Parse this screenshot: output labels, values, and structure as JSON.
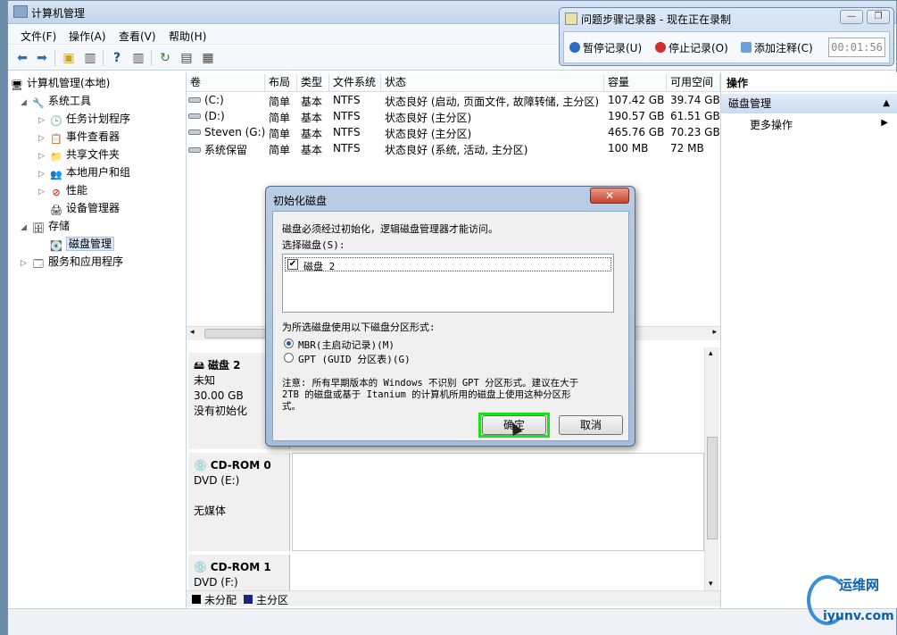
{
  "window": {
    "title": "计算机管理"
  },
  "menu": [
    "文件(F)",
    "操作(A)",
    "查看(V)",
    "帮助(H)"
  ],
  "toolbar": {
    "icons": [
      "back-arrow-icon",
      "forward-arrow-icon",
      "up-folder-icon",
      "show-hide-tree-icon",
      "help-icon",
      "show-hide-action-pane-icon",
      "refresh-icon",
      "properties-icon",
      "export-list-icon"
    ]
  },
  "tree": {
    "root": "计算机管理(本地)",
    "system_tools": "系统工具",
    "task_scheduler": "任务计划程序",
    "event_viewer": "事件查看器",
    "shared_folders": "共享文件夹",
    "local_users": "本地用户和组",
    "performance": "性能",
    "device_manager": "设备管理器",
    "storage": "存储",
    "disk_management": "磁盘管理",
    "services_apps": "服务和应用程序"
  },
  "volumes": {
    "headers": [
      "卷",
      "布局",
      "类型",
      "文件系统",
      "状态",
      "容量",
      "可用空间"
    ],
    "rows": [
      [
        "(C:)",
        "简单",
        "基本",
        "NTFS",
        "状态良好 (启动, 页面文件, 故障转储, 主分区)",
        "107.42 GB",
        "39.74 GB"
      ],
      [
        "(D:)",
        "简单",
        "基本",
        "NTFS",
        "状态良好 (主分区)",
        "190.57 GB",
        "61.51 GB"
      ],
      [
        "Steven (G:)",
        "简单",
        "基本",
        "NTFS",
        "状态良好 (主分区)",
        "465.76 GB",
        "70.23 GB"
      ],
      [
        "系统保留",
        "简单",
        "基本",
        "NTFS",
        "状态良好 (系统, 活动, 主分区)",
        "100 MB",
        "72 MB"
      ]
    ]
  },
  "disks": [
    {
      "name": "磁盘 2",
      "type": "未知",
      "size": "30.00 GB",
      "status": "没有初始化"
    },
    {
      "name": "CD-ROM 0",
      "type": "DVD (E:)",
      "size": "",
      "status": "无媒体"
    },
    {
      "name": "CD-ROM 1",
      "type": "DVD (F:)",
      "size": "",
      "status": ""
    }
  ],
  "legend": {
    "unallocated": "未分配",
    "primary": "主分区",
    "unallocated_color": "#000000",
    "primary_color": "#1a237e"
  },
  "actions": {
    "header": "操作",
    "section": "磁盘管理",
    "more": "更多操作"
  },
  "steps_recorder": {
    "title": "问题步骤记录器 - 现在正在录制",
    "pause": "暂停记录(U)",
    "stop": "停止记录(O)",
    "add_comment": "添加注释(C)",
    "timer": "00:01:56"
  },
  "dialog": {
    "title": "初始化磁盘",
    "message": "磁盘必须经过初始化，逻辑磁盘管理器才能访问。",
    "select_label": "选择磁盘(S):",
    "disk_item": "磁盘 2",
    "disk_checked": true,
    "partition_label": "为所选磁盘使用以下磁盘分区形式:",
    "mbr": "MBR(主启动记录)(M)",
    "gpt": "GPT (GUID 分区表)(G)",
    "selected_style": "MBR",
    "note": [
      "注意: 所有早期版本的 Windows 不识别 GPT 分区形式。建议在大于",
      "2TB 的磁盘或基于 Itanium 的计算机所用的磁盘上使用这种分区形",
      "式。"
    ],
    "ok": "确定",
    "cancel": "取消",
    "close": "✕"
  },
  "watermark": {
    "brand": "运维网",
    "domain": "iyunv.com"
  },
  "colors": {
    "highlight": "#18e418",
    "accent": "#3a8ed8"
  }
}
